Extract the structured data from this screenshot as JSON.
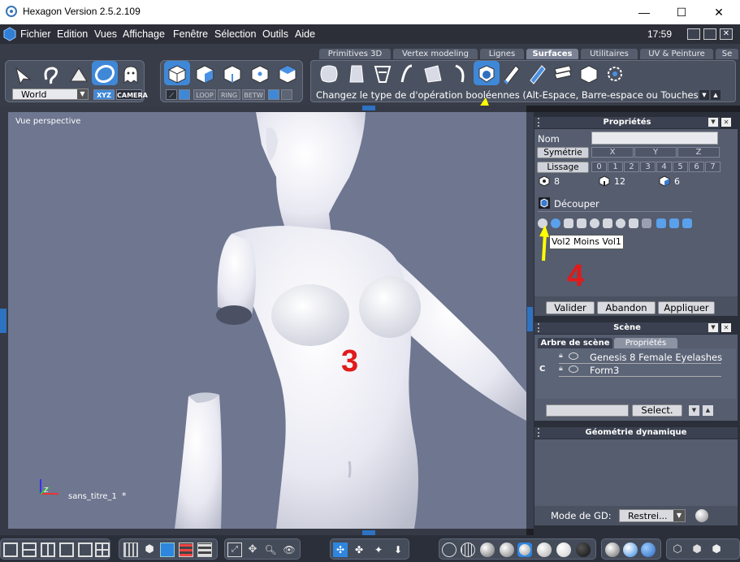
{
  "window": {
    "title": "Hexagon Version 2.5.2.109",
    "minimize": "—",
    "maximize": "☐",
    "close": "✕"
  },
  "menu": {
    "items": [
      "Fichier",
      "Edition",
      "Vues",
      "Affichage",
      "Fenêtre",
      "Sélection",
      "Outils",
      "Aide"
    ],
    "clock": "17:59"
  },
  "toolbar": {
    "tabs": [
      "Primitives 3D",
      "Vertex modeling",
      "Lignes",
      "Surfaces",
      "Utilitaires",
      "UV & Peinture",
      "Se"
    ],
    "active_tab": "Surfaces",
    "coord_select": "World",
    "xyz_label": "XYZ",
    "camera_label": "CAMERA",
    "select_modes": [
      "LOOP",
      "RING",
      "BETW"
    ],
    "hint": "Changez le type de d'opération booléennes (Alt-Espace, Barre-espace ou Touches + / -"
  },
  "viewport": {
    "label": "Vue perspective",
    "filename": "sans_titre_1",
    "modified_mark": "*",
    "annotation_number": "3"
  },
  "properties": {
    "title": "Propriétés",
    "name_label": "Nom",
    "name_value": "",
    "symmetry_label": "Symétrie",
    "symmetry_axes": [
      "X",
      "Y",
      "Z"
    ],
    "smoothing_label": "Lissage",
    "smoothing_levels": [
      "0",
      "1",
      "2",
      "3",
      "4",
      "5",
      "6",
      "7"
    ],
    "counts": [
      "8",
      "12",
      "6"
    ],
    "operation_label": "Découper",
    "tooltip": "Vol2 Moins Vol1",
    "annotation_number": "4",
    "buttons": [
      "Valider",
      "Abandon",
      "Appliquer"
    ]
  },
  "scene": {
    "title": "Scène",
    "tabs": [
      "Arbre de scène",
      "Propriétés"
    ],
    "items": [
      "Genesis 8 Female Eyelashes",
      "Form3"
    ],
    "select_button": "Select."
  },
  "dynamic_geometry": {
    "title": "Géométrie dynamique",
    "mode_label": "Mode de GD:",
    "mode_value": "Restrei..."
  },
  "colors": {
    "background": "#1e1f24",
    "viewport": "#6e7690",
    "panel": "#555d6f",
    "accent_arrow": "#ffff00",
    "annotation": "#e11a1a"
  }
}
